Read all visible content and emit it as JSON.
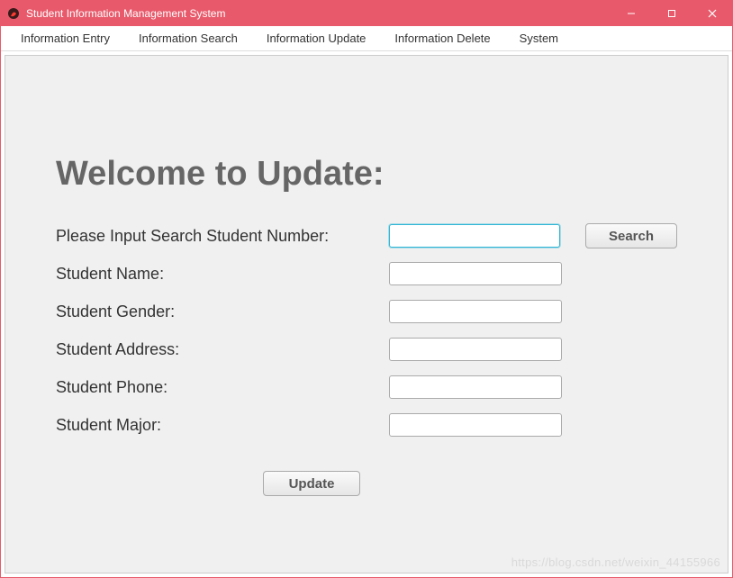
{
  "window": {
    "title": "Student Information Management System"
  },
  "menu": {
    "items": [
      "Information Entry",
      "Information Search",
      "Information Update",
      "Information Delete",
      "System"
    ]
  },
  "page": {
    "title": "Welcome to Update:"
  },
  "form": {
    "search_label": "Please Input Search Student Number:",
    "search_value": "",
    "search_button": "Search",
    "fields": [
      {
        "label": "Student Name:",
        "value": ""
      },
      {
        "label": "Student Gender:",
        "value": ""
      },
      {
        "label": "Student Address:",
        "value": ""
      },
      {
        "label": "Student Phone:",
        "value": ""
      },
      {
        "label": "Student Major:",
        "value": ""
      }
    ],
    "update_button": "Update"
  },
  "watermark": "https://blog.csdn.net/weixin_44155966"
}
